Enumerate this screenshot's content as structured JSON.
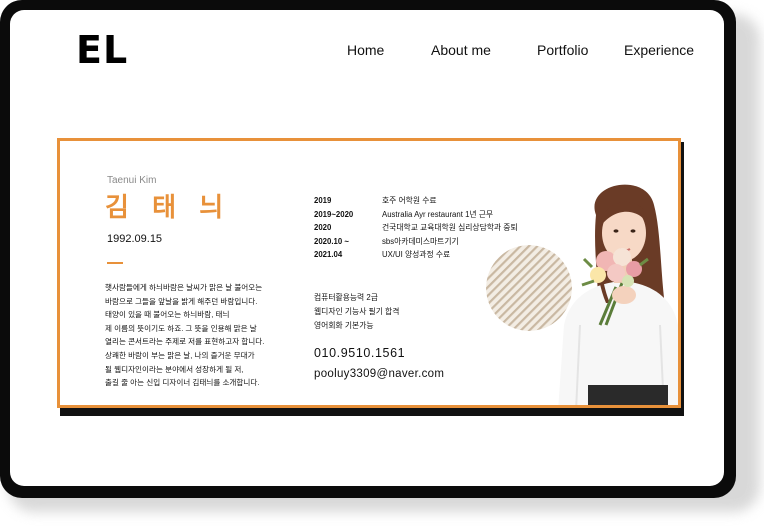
{
  "site": {
    "logo": "EL"
  },
  "nav": {
    "items": [
      {
        "label": "Home"
      },
      {
        "label": "About me"
      },
      {
        "label": "Portfolio"
      },
      {
        "label": "Experience"
      }
    ]
  },
  "profile": {
    "name_en": "Taenui Kim",
    "name_ko": "김 태 늬",
    "birth": "1992.09.15",
    "intro_lines": [
      "햇사람들에게 하늬바람은 날씨가 맑은 날 불어오는",
      "바람으로 그들을 앞날을 밝게 해주던 바람입니다.",
      "태양이 있을 때 불어오는 하늬바람, 태늬",
      "제 이름의 뜻이기도 하죠. 그 뜻을 인용해 맑은 날",
      "열리는 콘서트라는 주제로 저를 표현하고자 합니다.",
      "상쾌한 바람이 부는 맑은 날, 나의 즐거운 무대가",
      "될 웹디자인이라는 분야에서 성장하게 될 저,",
      "출길 줄 아는 신입 디자이너 김태늬를 소개합니다."
    ]
  },
  "timeline": [
    {
      "year": "2019",
      "desc": "호주 어학원 수료"
    },
    {
      "year": "2019~2020",
      "desc": "Australia Ayr restaurant 1년 근무"
    },
    {
      "year": "2020",
      "desc": "건국대학교 교육대학원 심리상담학과 중퇴"
    },
    {
      "year": "2020.10 ~",
      "desc": "sbs아카데미스마트기기"
    },
    {
      "year": "2021.04",
      "desc": "UX/UI 양성과정 수료"
    }
  ],
  "certifications": [
    "컴퓨터활용능력 2급",
    "웹디자인 기능사 필기 합격",
    "영어회화 기본가능"
  ],
  "contact": {
    "phone": "010.9510.1561",
    "email": "pooluy3309@naver.com"
  },
  "colors": {
    "accent": "#e8913a",
    "frame": "#0b0b0b",
    "text": "#111111"
  }
}
